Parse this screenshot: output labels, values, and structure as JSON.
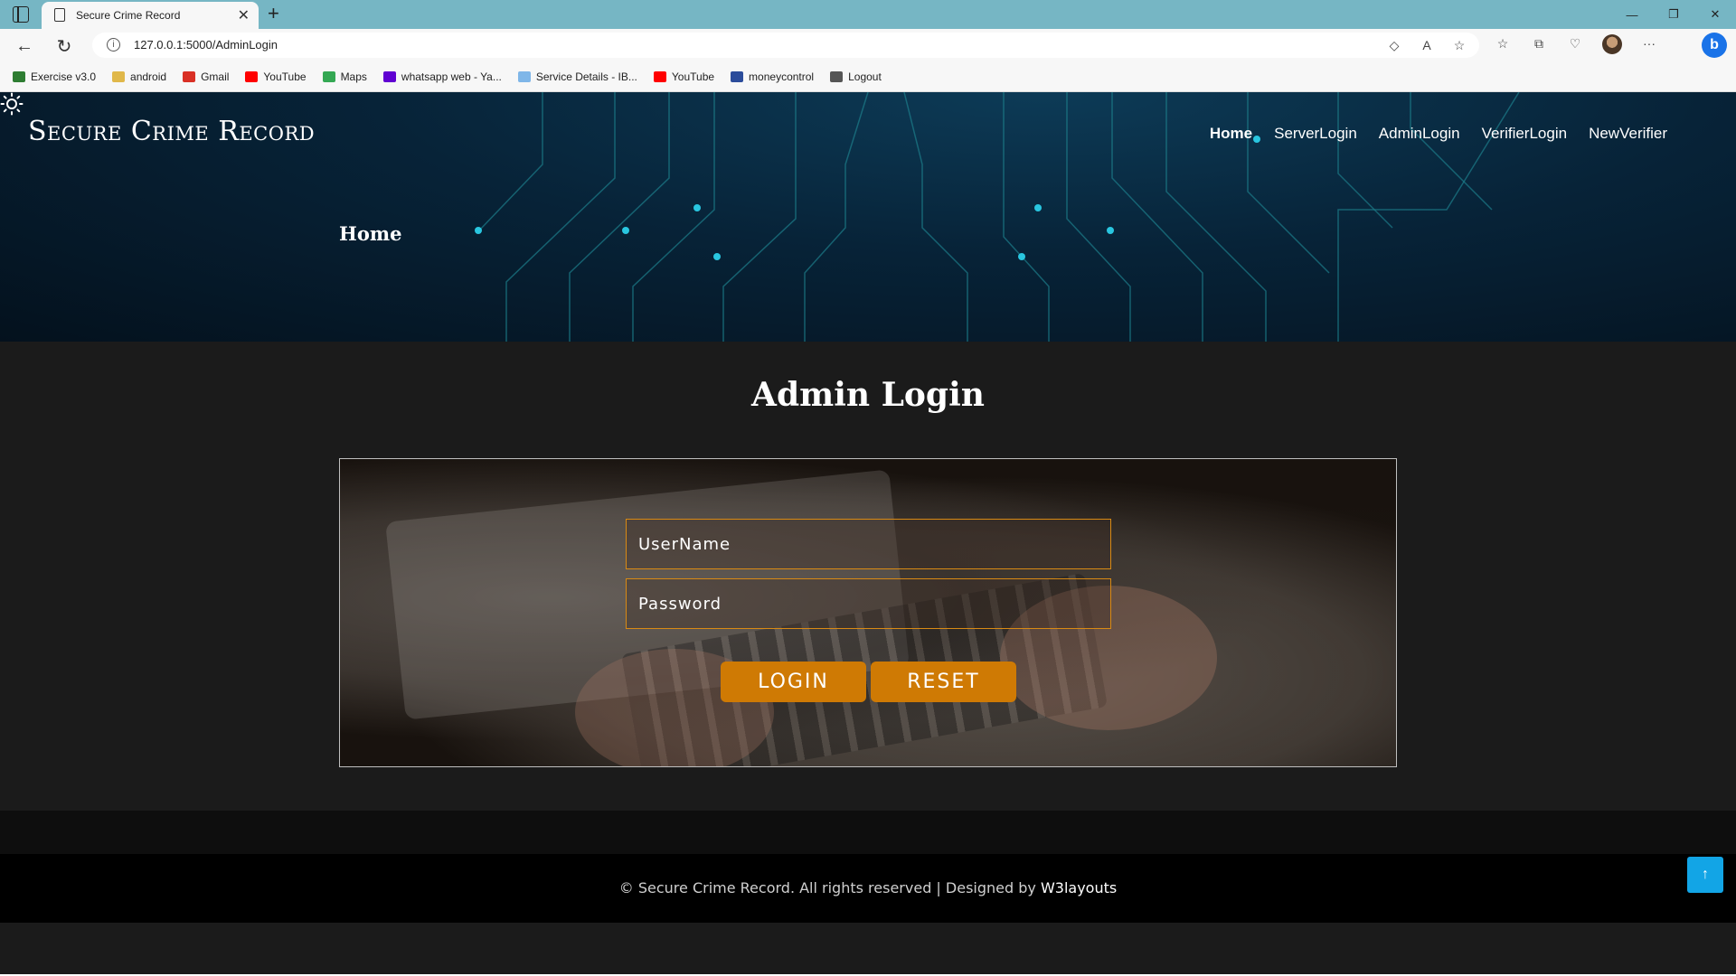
{
  "browser": {
    "tab_title": "Secure Crime Record",
    "url": "127.0.0.1:5000/AdminLogin",
    "bookmarks": [
      {
        "label": "Exercise v3.0",
        "icon": "w-logo-icon",
        "color": "#2e7d32"
      },
      {
        "label": "android",
        "icon": "folder-icon",
        "color": "#e0b84a"
      },
      {
        "label": "Gmail",
        "icon": "gmail-icon",
        "color": "#d93025"
      },
      {
        "label": "YouTube",
        "icon": "youtube-icon",
        "color": "#ff0000"
      },
      {
        "label": "Maps",
        "icon": "maps-pin-icon",
        "color": "#34a853"
      },
      {
        "label": "whatsapp web - Ya...",
        "icon": "yahoo-icon",
        "color": "#6001d2"
      },
      {
        "label": "Service Details - IB...",
        "icon": "cloud-icon",
        "color": "#7fb6e8"
      },
      {
        "label": "YouTube",
        "icon": "youtube-icon",
        "color": "#ff0000"
      },
      {
        "label": "moneycontrol",
        "icon": "moneycontrol-icon",
        "color": "#2b4c9b"
      },
      {
        "label": "Logout",
        "icon": "page-icon",
        "color": "#555555"
      }
    ]
  },
  "site": {
    "brand": "Secure Crime Record",
    "nav": [
      "Home",
      "ServerLogin",
      "AdminLogin",
      "VerifierLogin",
      "NewVerifier"
    ],
    "breadcrumb": "Home"
  },
  "form": {
    "title": "Admin Login",
    "username_placeholder": "UserName",
    "password_placeholder": "Password",
    "login_label": "LOGIN",
    "reset_label": "RESET"
  },
  "footer": {
    "text": "© Secure Crime Record. All rights reserved | Designed by ",
    "link": "W3layouts"
  },
  "colors": {
    "accent": "#cf7a04",
    "field_border": "#d98a14",
    "to_top": "#12a5e6"
  }
}
